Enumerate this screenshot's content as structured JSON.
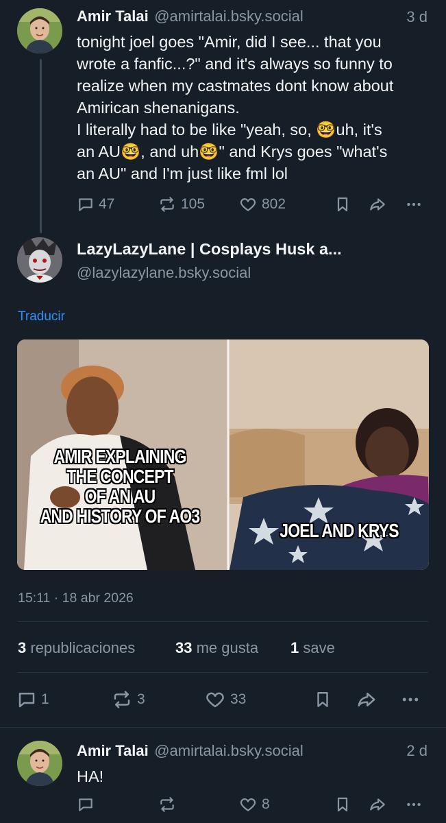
{
  "post1": {
    "name": "Amir Talai",
    "handle": "@amirtalai.bsky.social",
    "time": "3 d",
    "text": "tonight joel goes \"Amir, did I see... that you\nwrote a fanfic...?\" and it's always so funny to\nrealize when my castmates dont know about\nAmirican shenanigans.\nI literally had to be like \"yeah, so, 🤓uh, it's\nan AU🤓, and uh🤓\" and Krys goes \"what's\nan AU\" and I'm just like fml lol",
    "replies": "47",
    "reposts": "105",
    "likes": "802"
  },
  "post2": {
    "name": "LazyLazyLane | Cosplays Husk a...",
    "handle": "@lazylazylane.bsky.social",
    "translate": "Traducir",
    "meme_left_caption": "AMIR EXPLAINING\nTHE CONCEPT\nOF AN AU\nAND HISTORY OF AO3",
    "meme_right_caption": "JOEL AND KRYS",
    "timestamp": "15:11 · 18 abr 2026",
    "stats": {
      "reposts_count": "3",
      "reposts_label": "republicaciones",
      "likes_count": "33",
      "likes_label": "me gusta",
      "saves_count": "1",
      "saves_label": "save"
    },
    "replies": "1",
    "reposts": "3",
    "likes": "33"
  },
  "post3": {
    "name": "Amir Talai",
    "handle": "@amirtalai.bsky.social",
    "time": "2 d",
    "text": "HA!",
    "likes": "8"
  },
  "colors": {
    "background": "#161e27",
    "text": "#f1f3f5",
    "muted": "#8a96a3",
    "link": "#2f8ff5"
  }
}
